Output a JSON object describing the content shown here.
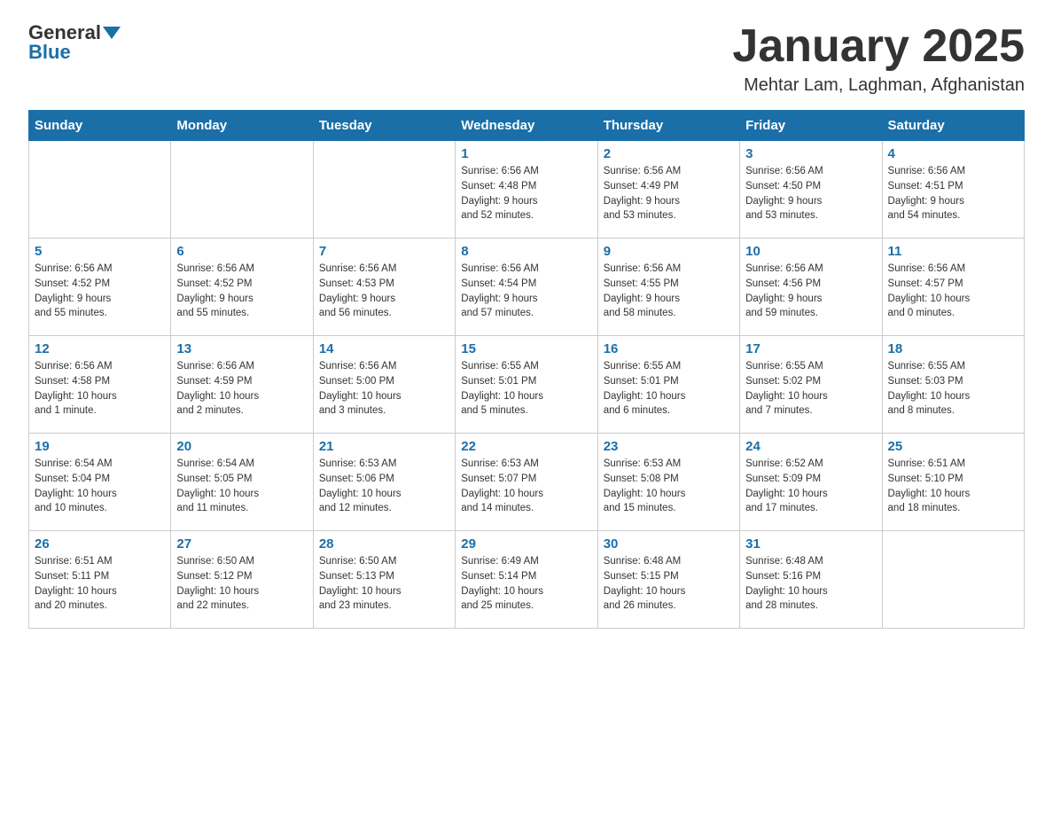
{
  "header": {
    "logo_general": "General",
    "logo_blue": "Blue",
    "title": "January 2025",
    "location": "Mehtar Lam, Laghman, Afghanistan"
  },
  "days_of_week": [
    "Sunday",
    "Monday",
    "Tuesday",
    "Wednesday",
    "Thursday",
    "Friday",
    "Saturday"
  ],
  "weeks": [
    [
      {
        "day": "",
        "info": ""
      },
      {
        "day": "",
        "info": ""
      },
      {
        "day": "",
        "info": ""
      },
      {
        "day": "1",
        "info": "Sunrise: 6:56 AM\nSunset: 4:48 PM\nDaylight: 9 hours\nand 52 minutes."
      },
      {
        "day": "2",
        "info": "Sunrise: 6:56 AM\nSunset: 4:49 PM\nDaylight: 9 hours\nand 53 minutes."
      },
      {
        "day": "3",
        "info": "Sunrise: 6:56 AM\nSunset: 4:50 PM\nDaylight: 9 hours\nand 53 minutes."
      },
      {
        "day": "4",
        "info": "Sunrise: 6:56 AM\nSunset: 4:51 PM\nDaylight: 9 hours\nand 54 minutes."
      }
    ],
    [
      {
        "day": "5",
        "info": "Sunrise: 6:56 AM\nSunset: 4:52 PM\nDaylight: 9 hours\nand 55 minutes."
      },
      {
        "day": "6",
        "info": "Sunrise: 6:56 AM\nSunset: 4:52 PM\nDaylight: 9 hours\nand 55 minutes."
      },
      {
        "day": "7",
        "info": "Sunrise: 6:56 AM\nSunset: 4:53 PM\nDaylight: 9 hours\nand 56 minutes."
      },
      {
        "day": "8",
        "info": "Sunrise: 6:56 AM\nSunset: 4:54 PM\nDaylight: 9 hours\nand 57 minutes."
      },
      {
        "day": "9",
        "info": "Sunrise: 6:56 AM\nSunset: 4:55 PM\nDaylight: 9 hours\nand 58 minutes."
      },
      {
        "day": "10",
        "info": "Sunrise: 6:56 AM\nSunset: 4:56 PM\nDaylight: 9 hours\nand 59 minutes."
      },
      {
        "day": "11",
        "info": "Sunrise: 6:56 AM\nSunset: 4:57 PM\nDaylight: 10 hours\nand 0 minutes."
      }
    ],
    [
      {
        "day": "12",
        "info": "Sunrise: 6:56 AM\nSunset: 4:58 PM\nDaylight: 10 hours\nand 1 minute."
      },
      {
        "day": "13",
        "info": "Sunrise: 6:56 AM\nSunset: 4:59 PM\nDaylight: 10 hours\nand 2 minutes."
      },
      {
        "day": "14",
        "info": "Sunrise: 6:56 AM\nSunset: 5:00 PM\nDaylight: 10 hours\nand 3 minutes."
      },
      {
        "day": "15",
        "info": "Sunrise: 6:55 AM\nSunset: 5:01 PM\nDaylight: 10 hours\nand 5 minutes."
      },
      {
        "day": "16",
        "info": "Sunrise: 6:55 AM\nSunset: 5:01 PM\nDaylight: 10 hours\nand 6 minutes."
      },
      {
        "day": "17",
        "info": "Sunrise: 6:55 AM\nSunset: 5:02 PM\nDaylight: 10 hours\nand 7 minutes."
      },
      {
        "day": "18",
        "info": "Sunrise: 6:55 AM\nSunset: 5:03 PM\nDaylight: 10 hours\nand 8 minutes."
      }
    ],
    [
      {
        "day": "19",
        "info": "Sunrise: 6:54 AM\nSunset: 5:04 PM\nDaylight: 10 hours\nand 10 minutes."
      },
      {
        "day": "20",
        "info": "Sunrise: 6:54 AM\nSunset: 5:05 PM\nDaylight: 10 hours\nand 11 minutes."
      },
      {
        "day": "21",
        "info": "Sunrise: 6:53 AM\nSunset: 5:06 PM\nDaylight: 10 hours\nand 12 minutes."
      },
      {
        "day": "22",
        "info": "Sunrise: 6:53 AM\nSunset: 5:07 PM\nDaylight: 10 hours\nand 14 minutes."
      },
      {
        "day": "23",
        "info": "Sunrise: 6:53 AM\nSunset: 5:08 PM\nDaylight: 10 hours\nand 15 minutes."
      },
      {
        "day": "24",
        "info": "Sunrise: 6:52 AM\nSunset: 5:09 PM\nDaylight: 10 hours\nand 17 minutes."
      },
      {
        "day": "25",
        "info": "Sunrise: 6:51 AM\nSunset: 5:10 PM\nDaylight: 10 hours\nand 18 minutes."
      }
    ],
    [
      {
        "day": "26",
        "info": "Sunrise: 6:51 AM\nSunset: 5:11 PM\nDaylight: 10 hours\nand 20 minutes."
      },
      {
        "day": "27",
        "info": "Sunrise: 6:50 AM\nSunset: 5:12 PM\nDaylight: 10 hours\nand 22 minutes."
      },
      {
        "day": "28",
        "info": "Sunrise: 6:50 AM\nSunset: 5:13 PM\nDaylight: 10 hours\nand 23 minutes."
      },
      {
        "day": "29",
        "info": "Sunrise: 6:49 AM\nSunset: 5:14 PM\nDaylight: 10 hours\nand 25 minutes."
      },
      {
        "day": "30",
        "info": "Sunrise: 6:48 AM\nSunset: 5:15 PM\nDaylight: 10 hours\nand 26 minutes."
      },
      {
        "day": "31",
        "info": "Sunrise: 6:48 AM\nSunset: 5:16 PM\nDaylight: 10 hours\nand 28 minutes."
      },
      {
        "day": "",
        "info": ""
      }
    ]
  ]
}
